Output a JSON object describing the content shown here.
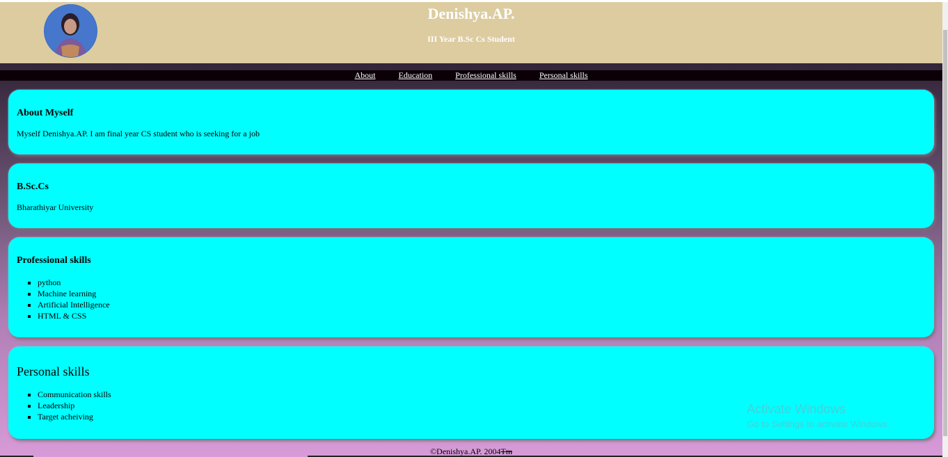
{
  "header": {
    "name": "Denishya.AP.",
    "subtitle": "III Year B.Sc Cs Student",
    "colors": {
      "header_bg": "#dccca0",
      "name_text": "#ffffff"
    }
  },
  "nav": {
    "items": [
      {
        "label": "About"
      },
      {
        "label": "Education"
      },
      {
        "label": "Professional skills"
      },
      {
        "label": "Personal skills"
      }
    ]
  },
  "sections": {
    "about": {
      "title": "About Myself",
      "text": "Myself Denishya.AP. I am final year CS student who is seeking for a job"
    },
    "education": {
      "title": "B.Sc.Cs",
      "text": "Bharathiyar University"
    },
    "professional": {
      "title": "Professional skills",
      "items": [
        "python",
        "Machine learning",
        "Artificial Intelligence",
        "HTML & CSS"
      ]
    },
    "personal": {
      "title": "Personal skills",
      "items": [
        "Communication skills",
        "Leadership",
        "Target acheiving"
      ]
    }
  },
  "footer": {
    "text": "©Denishya.AP. 2004",
    "tm": "Tm"
  },
  "watermark": {
    "line1": "Activate Windows",
    "line2": "Go to Settings to activate Windows."
  },
  "colors": {
    "card_bg": "#00ffff",
    "navbar_bg": "#0a0006"
  }
}
